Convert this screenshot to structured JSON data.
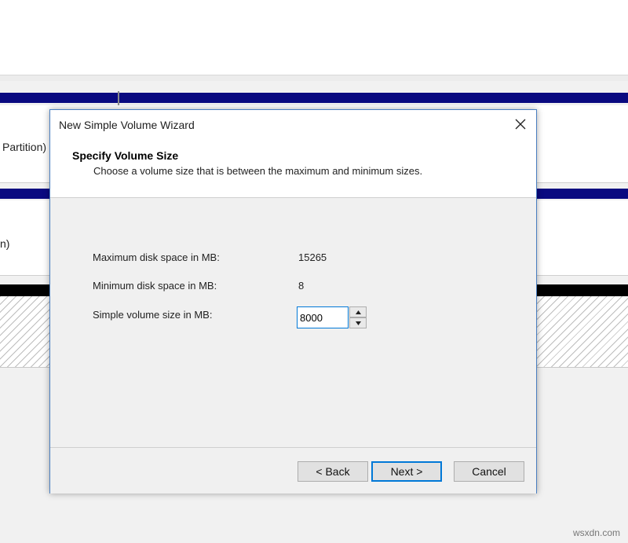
{
  "background": {
    "partition_text_1": "Partition)",
    "partition_text_2": "n)"
  },
  "dialog": {
    "title": "New Simple Volume Wizard",
    "header": {
      "title": "Specify Volume Size",
      "subtitle": "Choose a volume size that is between the maximum and minimum sizes."
    },
    "fields": {
      "max_label": "Maximum disk space in MB:",
      "max_value": "15265",
      "min_label": "Minimum disk space in MB:",
      "min_value": "8",
      "size_label": "Simple volume size in MB:",
      "size_value": "8000"
    },
    "buttons": {
      "back": "< Back",
      "next": "Next >",
      "cancel": "Cancel"
    }
  },
  "icons": {
    "close": "close-icon",
    "spin_up": "caret-up-icon",
    "spin_down": "caret-down-icon"
  },
  "watermark": "wsxdn.com"
}
